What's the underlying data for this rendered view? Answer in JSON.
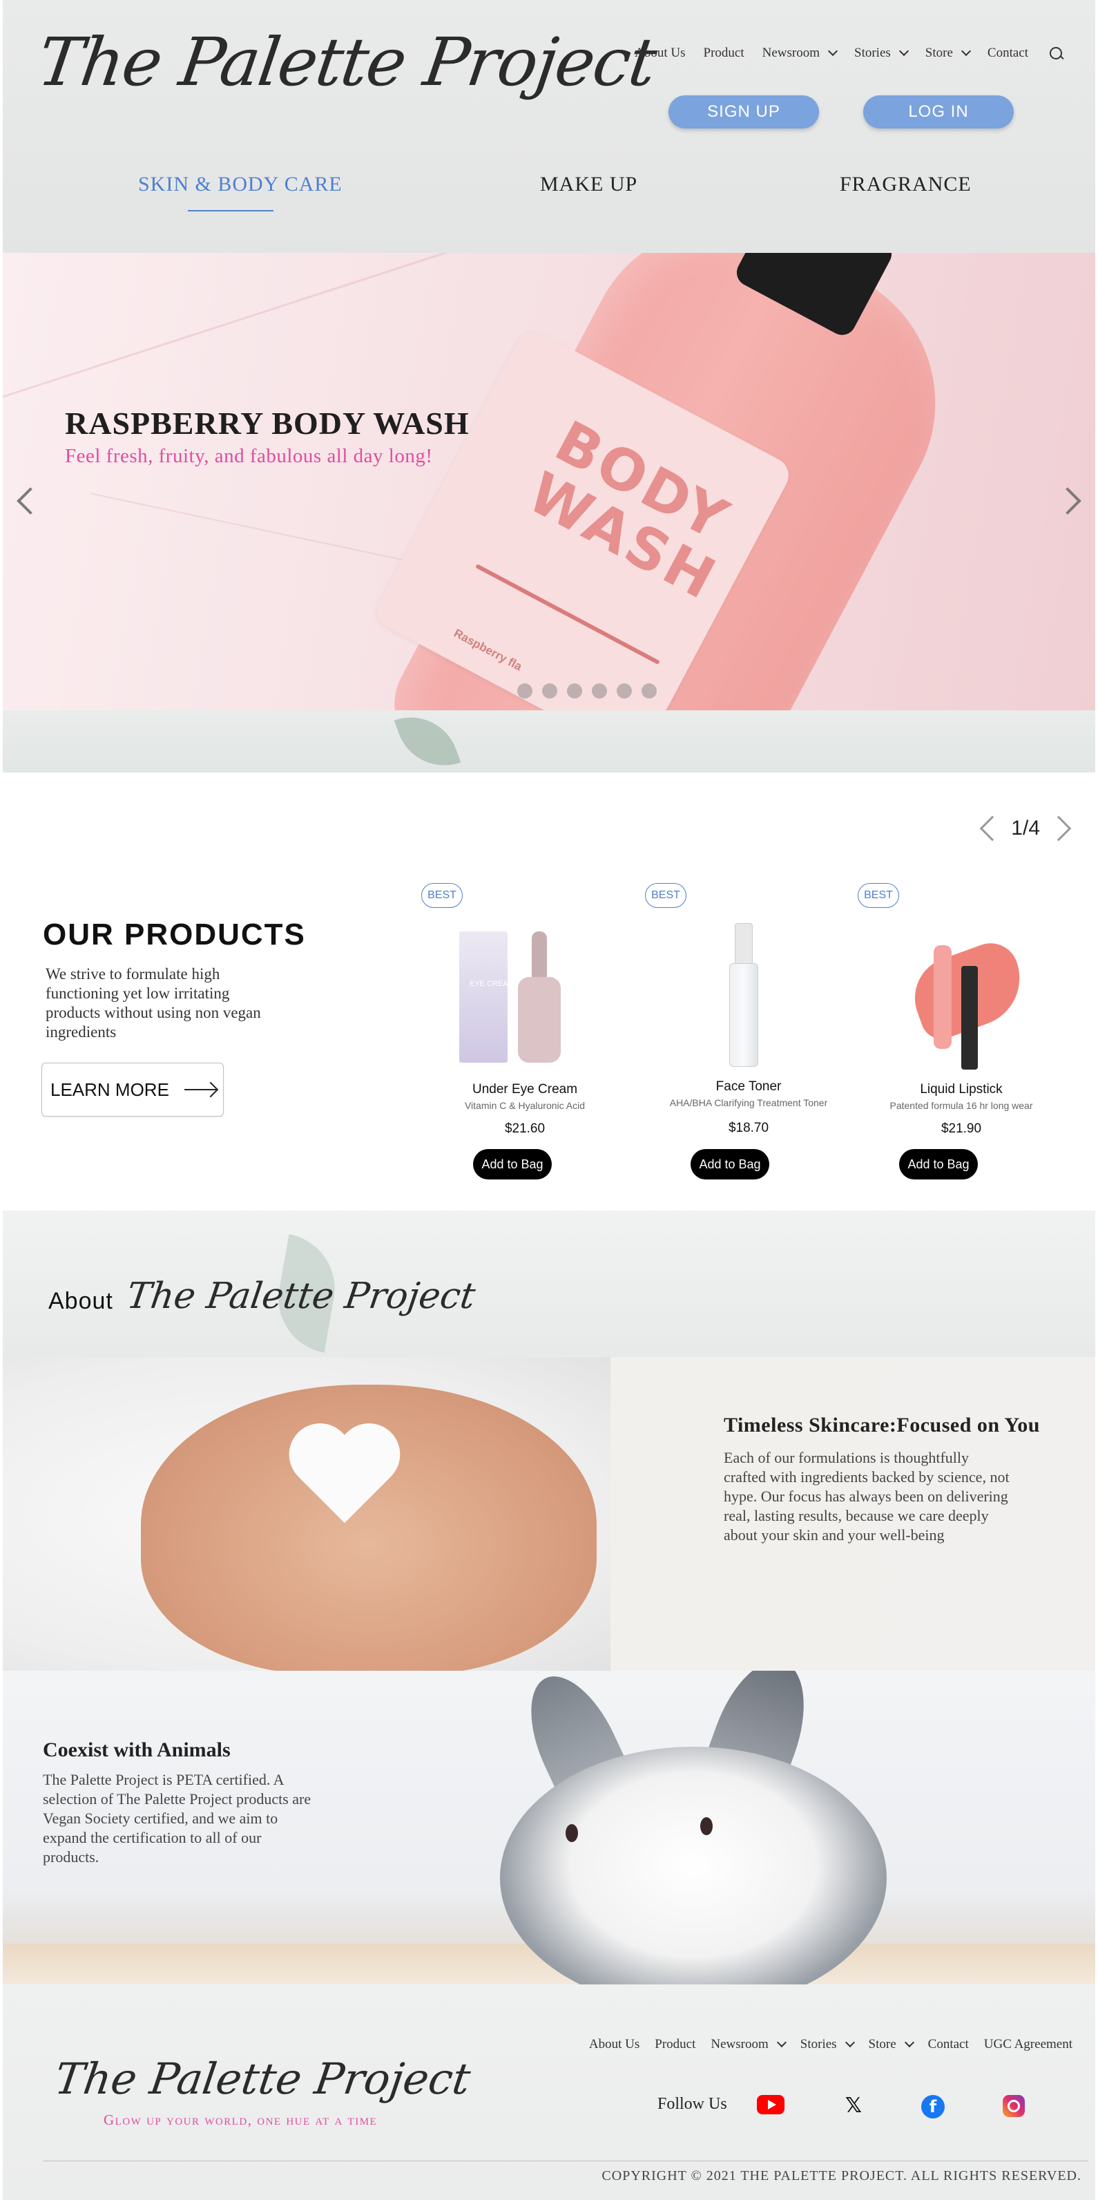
{
  "brand": {
    "logo_text": "The Palette Project"
  },
  "nav": {
    "items": [
      {
        "label": "About Us",
        "has_dropdown": false
      },
      {
        "label": "Product",
        "has_dropdown": false
      },
      {
        "label": "Newsroom",
        "has_dropdown": true
      },
      {
        "label": "Stories",
        "has_dropdown": true
      },
      {
        "label": "Store",
        "has_dropdown": true
      },
      {
        "label": "Contact",
        "has_dropdown": false
      }
    ],
    "search_icon": "search-icon"
  },
  "auth": {
    "signup_label": "SIGN UP",
    "login_label": "LOG IN"
  },
  "categories": {
    "items": [
      {
        "label": "SKIN & BODY CARE",
        "active": true
      },
      {
        "label": "MAKE UP",
        "active": false
      },
      {
        "label": "FRAGRANCE",
        "active": false
      }
    ]
  },
  "hero": {
    "title": "RASPBERRY BODY WASH",
    "subtitle": "Feel fresh, fruity, and fabulous all day long!",
    "label_text": "BODY\nWASH",
    "label_small": "Raspberry fla",
    "slide_count": 6,
    "active_slide": 0
  },
  "products": {
    "title": "OUR PRODUCTS",
    "description": "We strive to formulate high functioning yet low irritating products without using non vegan ingredients",
    "learn_more_label": "LEARN MORE",
    "pager": {
      "current": "1",
      "separator": "/",
      "total": "4"
    },
    "items": [
      {
        "badge": "BEST",
        "name": "Under Eye Cream",
        "subtitle": "Vitamin C & Hyaluronic Acid",
        "price": "$21.60",
        "button": "Add to Bag",
        "box_label": "EYE CREAM"
      },
      {
        "badge": "BEST",
        "name": "Face Toner",
        "subtitle": "AHA/BHA  Clarifying Treatment Toner",
        "price": "$18.70",
        "button": "Add to Bag"
      },
      {
        "badge": "BEST",
        "name": "Liquid Lipstick",
        "subtitle": "Patented formula 16 hr long wear",
        "price": "$21.90",
        "button": "Add to Bag"
      }
    ]
  },
  "about": {
    "prefix": "About",
    "brand_script": "The Palette Project",
    "skincare": {
      "title": "Timeless Skincare:Focused on You",
      "text": "Each of our formulations is thoughtfully crafted with ingredients backed by science, not hype. Our focus has always been on delivering real, lasting results, because we care deeply about your skin and your well-being"
    },
    "animals": {
      "title": "Coexist with Animals",
      "text": "The Palette Project is PETA certified. A selection of The Palette Project products are Vegan Society certified, and we aim to expand the certification to all of our products."
    }
  },
  "footer": {
    "nav": [
      {
        "label": "About Us",
        "has_dropdown": false
      },
      {
        "label": "Product",
        "has_dropdown": false
      },
      {
        "label": "Newsroom",
        "has_dropdown": true
      },
      {
        "label": "Stories",
        "has_dropdown": true
      },
      {
        "label": "Store",
        "has_dropdown": true
      },
      {
        "label": "Contact",
        "has_dropdown": false
      },
      {
        "label": "UGC Agreement",
        "has_dropdown": false
      }
    ],
    "logo_text": "The Palette Project",
    "tagline": "Glow up your world, one hue at a time",
    "follow_label": "Follow Us",
    "social": [
      "youtube-icon",
      "x-icon",
      "facebook-icon",
      "instagram-icon"
    ],
    "copyright": "COPYRIGHT © 2021 THE PALETTE PROJECT. ALL RIGHTS RESERVED."
  },
  "colors": {
    "accent_blue": "#7ba3dd",
    "link_blue": "#4f7fd1",
    "accent_pink": "#e04da0"
  }
}
